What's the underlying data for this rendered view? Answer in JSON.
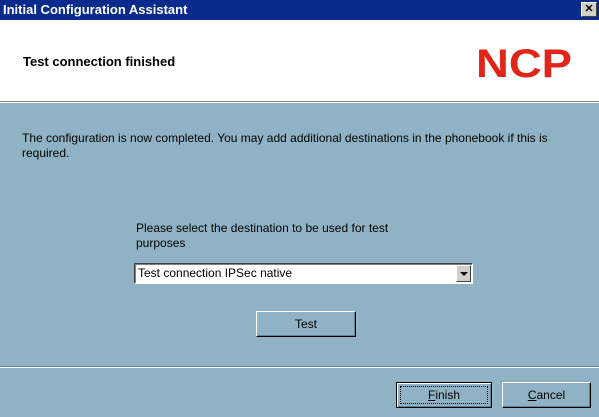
{
  "window": {
    "title": "Initial Configuration Assistant",
    "close_glyph": "✕"
  },
  "header": {
    "title": "Test connection finished",
    "logo_text": "NCP",
    "logo_color": "#e0261b"
  },
  "message": "The configuration is now completed. You may add additional destinations in the phonebook if this is required.",
  "destination": {
    "label": "Please select the destination to be used for test purposes",
    "selected": "Test connection IPSec native"
  },
  "buttons": {
    "test": "Test",
    "finish_first": "F",
    "finish_rest": "inish",
    "cancel_first": "C",
    "cancel_rest": "ancel"
  },
  "colors": {
    "body": "#8fb3c4",
    "titlebar": "#0a2a8c"
  }
}
